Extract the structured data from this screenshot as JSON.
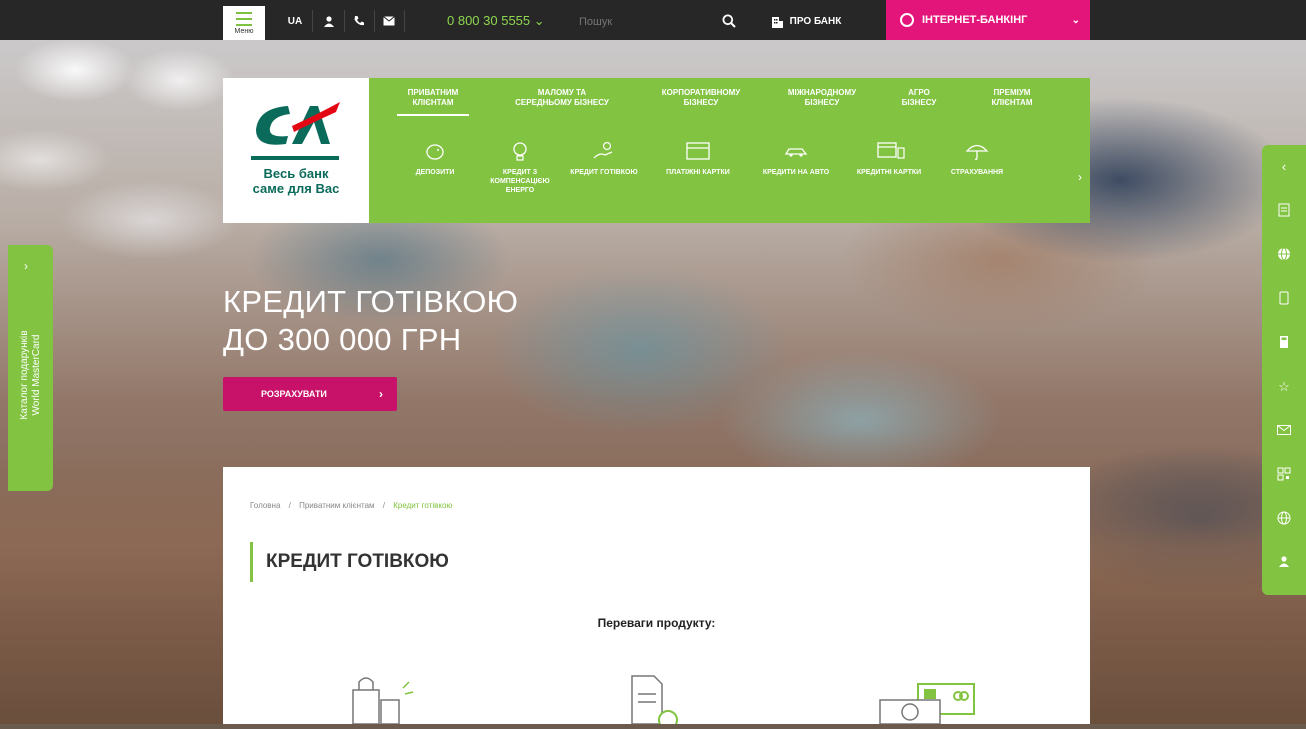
{
  "topbar": {
    "menu_label": "Меню",
    "lang": "UA",
    "phone": "0 800 30 5555 ⌄",
    "search_placeholder": "Пошук",
    "about_label": "ПРО БАНК",
    "ibanking_label": "ІНТЕРНЕТ-БАНКІНГ"
  },
  "logo": {
    "tagline_line1": "Весь банк",
    "tagline_line2": "саме для Вас"
  },
  "segments": [
    {
      "line1": "ПРИВАТНИМ",
      "line2": "КЛІЄНТАМ"
    },
    {
      "line1": "МАЛОМУ ТА",
      "line2": "СЕРЕДНЬОМУ БІЗНЕСУ"
    },
    {
      "line1": "КОРПОРАТИВНОМУ",
      "line2": "БІЗНЕСУ"
    },
    {
      "line1": "МІЖНАРОДНОМУ",
      "line2": "БІЗНЕСУ"
    },
    {
      "line1": "АГРО",
      "line2": "БІЗНЕСУ"
    },
    {
      "line1": "ПРЕМІУМ",
      "line2": "КЛІЄНТАМ"
    }
  ],
  "products": [
    {
      "label": "ДЕПОЗИТИ",
      "icon": "piggy-bank-icon"
    },
    {
      "label": "КРЕДИТ З КОМПЕНСАЦІЄЮ ЕНЕРГО",
      "icon": "lightbulb-icon"
    },
    {
      "label": "КРЕДИТ ГОТІВКОЮ",
      "icon": "hand-money-icon"
    },
    {
      "label": "ПЛАТІЖНІ КАРТКИ",
      "icon": "card-icon"
    },
    {
      "label": "КРЕДИТИ НА АВТО",
      "icon": "car-icon"
    },
    {
      "label": "КРЕДИТНІ КАРТКИ",
      "icon": "credit-card-icon"
    },
    {
      "label": "СТРАХУВАННЯ",
      "icon": "umbrella-icon"
    }
  ],
  "hero": {
    "title_line1": "КРЕДИТ ГОТІВКОЮ",
    "title_line2": "ДО 300 000 ГРН",
    "button_label": "РОЗРАХУВАТИ"
  },
  "left_tab": {
    "line1": "Каталог подарунків",
    "line2": "World MasterCard"
  },
  "breadcrumb": {
    "items": [
      "Головна",
      "Приватним клієнтам",
      "Кредит готівкою"
    ],
    "separator": "/"
  },
  "content": {
    "page_title": "КРЕДИТ ГОТІВКОЮ",
    "advantages_title": "Переваги продукту:"
  },
  "colors": {
    "accent_green": "#82c341",
    "accent_pink": "#e4157a",
    "brand_teal": "#0b6b5a"
  }
}
